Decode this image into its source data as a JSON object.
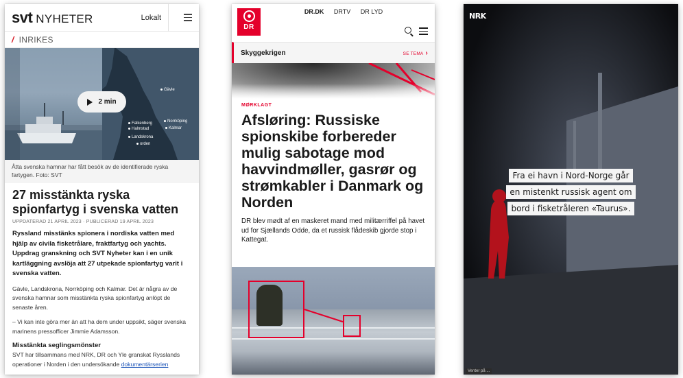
{
  "svt": {
    "logo_mark": "svt",
    "logo_word": "NYHETER",
    "nav_lokalt": "Lokalt",
    "section": "INRIKES",
    "video_duration": "2 min",
    "map_cities": [
      "Gävle",
      "Norrköping",
      "Kalmar",
      "Falkenberg",
      "Halmstad",
      "Landskrona",
      "orden"
    ],
    "photo_caption": "Åtta svenska hamnar har fått besök av de identifierade ryska fartygen. Foto: SVT",
    "title": "27 misstänkta ryska spionfartyg i svenska vatten",
    "meta": "UPPDATERAD 21 APRIL 2023 · PUBLICERAD 19 APRIL 2023",
    "lead": "Ryssland misstänks spionera i nordiska vatten med hjälp av civila fisketrålare, fraktfartyg och yachts. Uppdrag granskning och SVT Nyheter kan i en unik kartläggning avslöja att 27 utpekade spionfartyg varit i svenska vatten.",
    "p1": "Gävle, Landskrona, Norrköping och Kalmar. Det är några av de svenska hamnar som misstänkta ryska spionfartyg anlöpt de senaste åren.",
    "p2": "– Vi kan inte göra mer än att ha dem under uppsikt, säger svenska marinens pressofficer Jimmie Adamsson.",
    "subheading": "Misstänkta seglingsmönster",
    "p3_text": "SVT har tillsammans med NRK, DR och Yle granskat Rysslands operationer i Norden i den undersökande ",
    "p3_link": "dokumentärserien",
    "accent_color": "#d5101b"
  },
  "dr": {
    "logo_text": "DR",
    "topnav": [
      "DR.DK",
      "DRTV",
      "DR LYD"
    ],
    "topnav_active": "DR.DK",
    "theme_name": "Skyggekrigen",
    "theme_link": "SE TEMA",
    "kicker": "MØRKLAGT",
    "title_strong": "Afsløring:",
    "title_rest": " Russiske spionskibe forbereder mulig sabotage mod havvindmøller, gasrør og strømkabler i Danmark og Norden",
    "lead": "DR blev mødt af en maskeret mand med militærriffel på havet ud for Sjællands Odde, da et russisk flådeskib gjorde stop i Kattegat.",
    "accent_color": "#e4002b"
  },
  "nrk": {
    "logo": "NRK",
    "caption_lines": [
      "Fra ei havn i Nord-Norge går",
      "en mistenkt russisk agent om",
      "bord i fisketråleren «Taurus»."
    ],
    "status": "Venter på ..."
  }
}
